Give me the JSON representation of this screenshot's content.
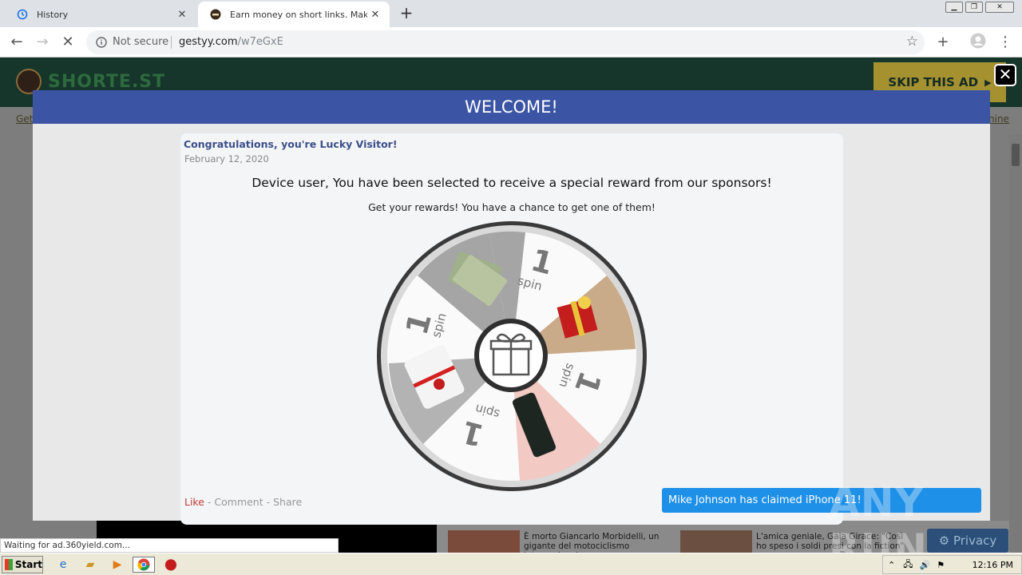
{
  "tabs": [
    {
      "title": "History",
      "icon": "history-icon",
      "active": false
    },
    {
      "title": "Earn money on short links. Make sho",
      "icon": "shortest-favicon",
      "active": true
    }
  ],
  "toolbar": {
    "security_label": "Not secure",
    "url_host": "gestyy.com",
    "url_path": "/w7eGxE"
  },
  "site": {
    "logo_text": "SHORTE.ST",
    "skip_ad_label": "SKIP THIS AD",
    "nav_left": "Get",
    "nav_right": "nine"
  },
  "modal": {
    "header": "WELCOME!",
    "title": "Congratulations, you're Lucky Visitor!",
    "date": "February 12, 2020",
    "headline": "Device user, You have been selected to receive a special reward from our sponsors!",
    "subtitle": "Get your rewards! You have a chance to get one of them!",
    "wheel_labels": [
      "1",
      "spin",
      "1",
      "spin",
      "1",
      "spin",
      "1",
      "spin"
    ],
    "actions": {
      "like": "Like",
      "sep1": " - ",
      "comment": "Comment",
      "sep2": " - ",
      "share": "Share"
    }
  },
  "toast": "Mike Johnson has claimed iPhone 11!",
  "news": [
    {
      "text": "È morto Giancarlo Morbidelli, un gigante del motociclismo internazionale"
    },
    {
      "text": "L'amica geniale, Gaia Girace: \"Così ho speso i soldi presi con la fiction\""
    }
  ],
  "privacy_label": "Privacy",
  "watermark": "ANY RUN",
  "status_text": "Waiting for ad.360yield.com...",
  "taskbar": {
    "start_label": "Start",
    "clock": "12:16 PM"
  },
  "colors": {
    "modal_header": "#3b55a4",
    "toast": "#1e90e8",
    "site_header": "#16362b",
    "skip_ad": "#a5912f"
  }
}
